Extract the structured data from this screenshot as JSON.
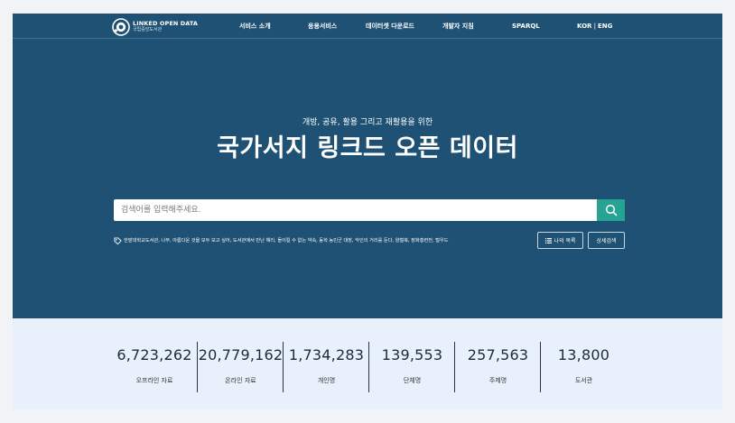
{
  "header": {
    "logo": {
      "title": "LINKED OPEN DATA",
      "subtitle": "국립중앙도서관"
    },
    "nav": [
      "서비스 소개",
      "응용서비스",
      "데이터셋 다운로드",
      "개발자 지침",
      "SPARQL"
    ],
    "lang": {
      "kor": "KOR",
      "sep": "|",
      "eng": "ENG"
    }
  },
  "hero": {
    "subtitle": "개방, 공유, 활용 그리고 재활용을 위한",
    "title": "국가서지 링크드 오픈 데이터"
  },
  "search": {
    "placeholder": "검색어를 입력해주세요.",
    "button_icon": "search-icon"
  },
  "tags": [
    "한밭대학교도서관",
    "나무",
    "아름다운 것을 모두 보고 싶어",
    "도서관에서 만난 해리",
    "돌이킬 수 없는 약속",
    "동학 농민군 대장",
    "악인의 거리를 둔다",
    "양철북",
    "장화홍련전",
    "털우드"
  ],
  "buttons": {
    "my_list": "나의 목록",
    "advanced": "상세검색"
  },
  "stats": [
    {
      "value": "6,723,262",
      "label": "오프라인 자료"
    },
    {
      "value": "20,779,162",
      "label": "온라인 자료"
    },
    {
      "value": "1,734,283",
      "label": "개인명"
    },
    {
      "value": "139,553",
      "label": "단체명"
    },
    {
      "value": "257,563",
      "label": "주제명"
    },
    {
      "value": "13,800",
      "label": "도서관"
    }
  ]
}
